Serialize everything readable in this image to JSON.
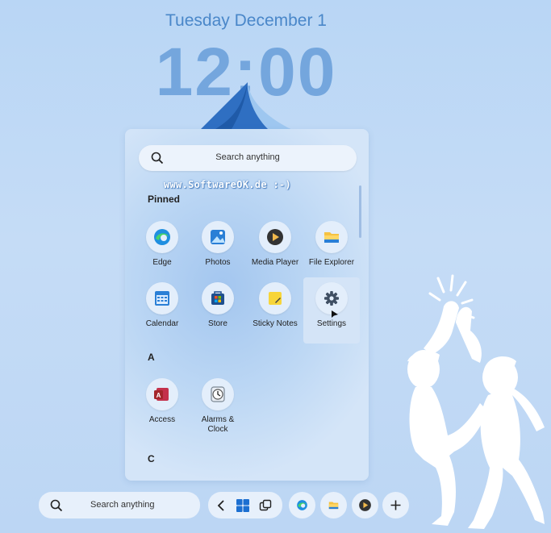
{
  "lock_screen": {
    "date": "Tuesday December 1",
    "time": "12:00"
  },
  "watermark": "www.SoftwareOK.de :-)",
  "start_menu": {
    "search_placeholder": "Search anything",
    "pinned_title": "Pinned",
    "pinned": [
      {
        "label": "Edge",
        "icon": "edge-icon"
      },
      {
        "label": "Photos",
        "icon": "photos-icon"
      },
      {
        "label": "Media Player",
        "icon": "media-player-icon"
      },
      {
        "label": "File Explorer",
        "icon": "folder-icon"
      },
      {
        "label": "Calendar",
        "icon": "calendar-icon"
      },
      {
        "label": "Store",
        "icon": "store-icon"
      },
      {
        "label": "Sticky Notes",
        "icon": "sticky-notes-icon"
      },
      {
        "label": "Settings",
        "icon": "gear-icon"
      }
    ],
    "section_a": "A",
    "a_apps": [
      {
        "label": "Access",
        "icon": "access-icon"
      },
      {
        "label": "Alarms &\nClock",
        "label_line1": "Alarms &",
        "label_line2": "Clock",
        "icon": "clock-icon"
      }
    ],
    "section_c": "C"
  },
  "taskbar": {
    "search_placeholder": "Search anything",
    "buttons": [
      "back-icon",
      "windows-start-icon",
      "task-view-icon",
      "edge-icon",
      "folder-icon",
      "media-player-icon",
      "plus-icon"
    ]
  },
  "colors": {
    "accent": "#3a7fcb",
    "background": "#c5dcf6"
  }
}
